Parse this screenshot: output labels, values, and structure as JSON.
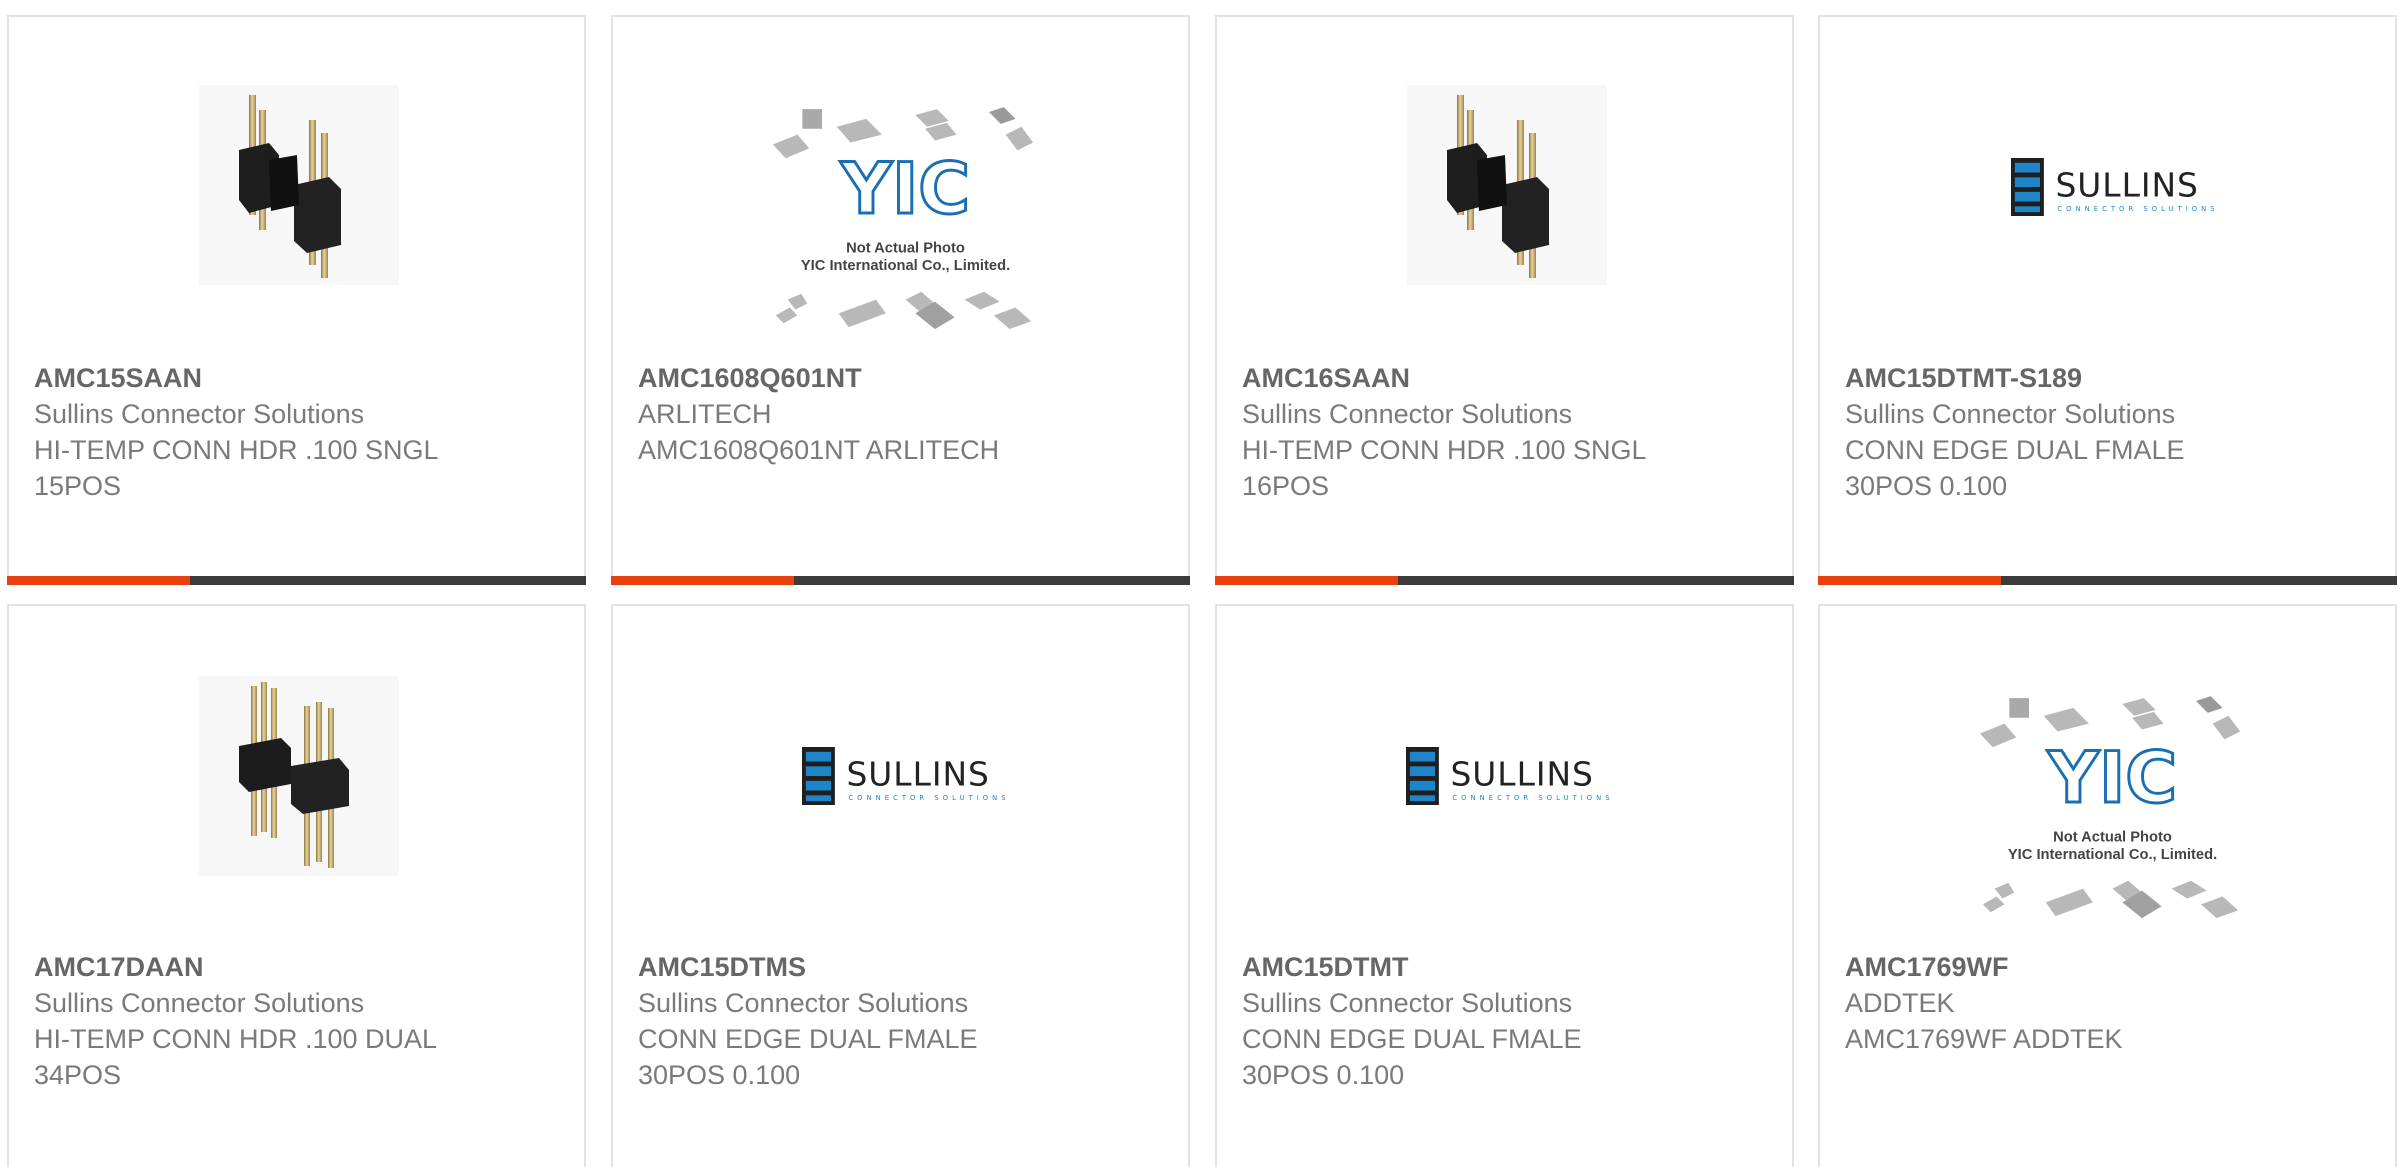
{
  "colors": {
    "accent": "#e8400e",
    "bar_track": "#3b3b3b",
    "sullins_blue": "#1e86c8",
    "yic_blue": "#1a6fb3"
  },
  "products": [
    {
      "part": "AMC15SAAN",
      "maker": "Sullins Connector Solutions",
      "desc1": "HI-TEMP CONN HDR .100 SNGL",
      "desc2": "15POS",
      "image": "pin-header-photo"
    },
    {
      "part": "AMC1608Q601NT",
      "maker": "ARLITECH",
      "desc1": "AMC1608Q601NT ARLITECH",
      "desc2": "",
      "image": "yic-placeholder-photo"
    },
    {
      "part": "AMC16SAAN",
      "maker": "Sullins Connector Solutions",
      "desc1": "HI-TEMP CONN HDR .100 SNGL",
      "desc2": "16POS",
      "image": "pin-header-photo"
    },
    {
      "part": "AMC15DTMT-S189",
      "maker": "Sullins Connector Solutions",
      "desc1": "CONN EDGE DUAL FMALE",
      "desc2": "30POS 0.100",
      "image": "sullins-logo"
    },
    {
      "part": "AMC17DAAN",
      "maker": "Sullins Connector Solutions",
      "desc1": "HI-TEMP CONN HDR .100 DUAL",
      "desc2": "34POS",
      "image": "dual-pin-header-photo"
    },
    {
      "part": "AMC15DTMS",
      "maker": "Sullins Connector Solutions",
      "desc1": "CONN EDGE DUAL FMALE",
      "desc2": "30POS 0.100",
      "image": "sullins-logo"
    },
    {
      "part": "AMC15DTMT",
      "maker": "Sullins Connector Solutions",
      "desc1": "CONN EDGE DUAL FMALE",
      "desc2": "30POS 0.100",
      "image": "sullins-logo"
    },
    {
      "part": "AMC1769WF",
      "maker": "ADDTEK",
      "desc1": "AMC1769WF ADDTEK",
      "desc2": "",
      "image": "yic-placeholder-photo"
    }
  ],
  "sullins_logo": {
    "wordmark": "SULLINS",
    "tagline": "CONNECTOR SOLUTIONS"
  },
  "yic_placeholder": {
    "mark": "YIC",
    "note1": "Not Actual Photo",
    "note2": "YIC International Co., Limited."
  }
}
